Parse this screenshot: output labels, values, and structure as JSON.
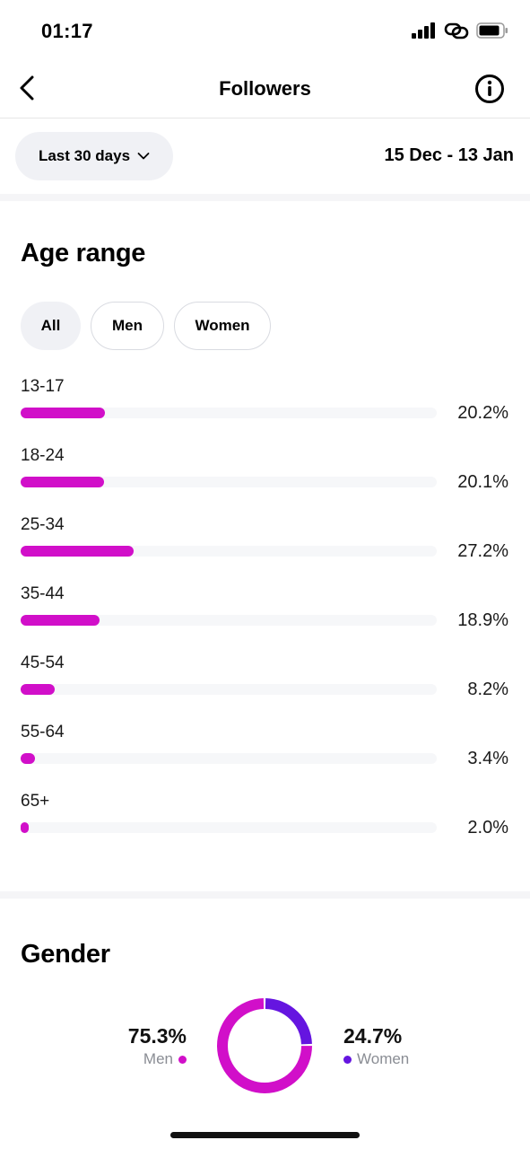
{
  "status_bar": {
    "time": "01:17"
  },
  "nav": {
    "title": "Followers"
  },
  "filter": {
    "period_label": "Last 30 days",
    "date_range": "15 Dec - 13 Jan"
  },
  "age_range": {
    "title": "Age range",
    "tabs": [
      {
        "label": "All",
        "active": true
      },
      {
        "label": "Men",
        "active": false
      },
      {
        "label": "Women",
        "active": false
      }
    ],
    "rows": [
      {
        "label": "13-17",
        "percent_text": "20.2%",
        "value": 20.2
      },
      {
        "label": "18-24",
        "percent_text": "20.1%",
        "value": 20.1
      },
      {
        "label": "25-34",
        "percent_text": "27.2%",
        "value": 27.2
      },
      {
        "label": "35-44",
        "percent_text": "18.9%",
        "value": 18.9
      },
      {
        "label": "45-54",
        "percent_text": "8.2%",
        "value": 8.2
      },
      {
        "label": "55-64",
        "percent_text": "3.4%",
        "value": 3.4
      },
      {
        "label": "65+",
        "percent_text": "2.0%",
        "value": 2.0
      }
    ],
    "bar_color": "#d10fc9",
    "track_color": "#f6f7f9"
  },
  "gender": {
    "title": "Gender",
    "men": {
      "percent_text": "75.3%",
      "label": "Men",
      "value": 75.3,
      "color": "#d10fc9"
    },
    "women": {
      "percent_text": "24.7%",
      "label": "Women",
      "value": 24.7,
      "color": "#6515e0"
    }
  }
}
